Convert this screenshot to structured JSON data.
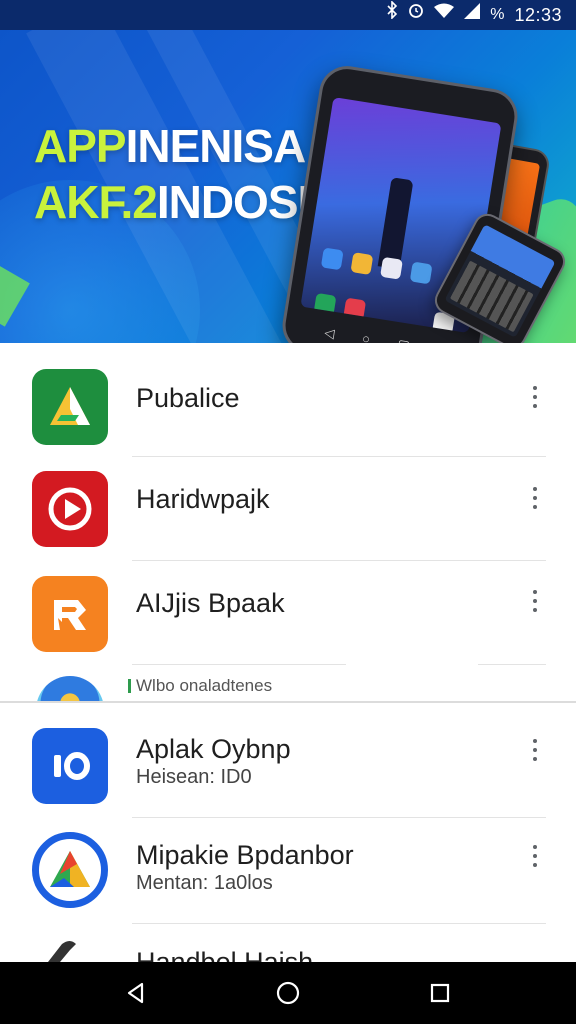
{
  "status_bar": {
    "time": "12:33",
    "icons": [
      "bluetooth-icon",
      "alarm-icon",
      "wifi-icon",
      "signal-icon",
      "battery-percent-icon"
    ],
    "battery_glyph": "%",
    "background": "#0b2a6b"
  },
  "banner": {
    "line1_accent": "APP",
    "line1_rest": "INENISA",
    "line2_accent": "AKF.2",
    "line2_rest": "INDOSIA",
    "accent_color": "#c9f23c"
  },
  "apps": [
    {
      "name": "Pubalice",
      "sub": "",
      "icon": "triangle-a-icon",
      "icon_bg": "#1e8e3e"
    },
    {
      "name": "Haridwpajk",
      "sub": "",
      "icon": "play-icon",
      "icon_bg": "#d31a21"
    },
    {
      "name": "AIJjis Bpaak",
      "sub": "",
      "icon": "r-logo-icon",
      "icon_bg": "#f58220"
    },
    {
      "name": "Aplak Oybnp",
      "sub": "Heisean: ID0",
      "icon": "io-logo-icon",
      "icon_bg": "#1c5fe0"
    },
    {
      "name": "Mipakie Bpdanbor",
      "sub": "Mentan: 1a0los",
      "icon": "tri-circle-icon",
      "icon_bg": "#ffffff"
    }
  ],
  "partial_row": {
    "label": "Wlbo onaladtenes"
  },
  "bottom_partial": {
    "label": "Handbol Haish"
  },
  "nav_bar": {
    "buttons": [
      "back-icon",
      "home-icon",
      "recents-icon"
    ]
  }
}
